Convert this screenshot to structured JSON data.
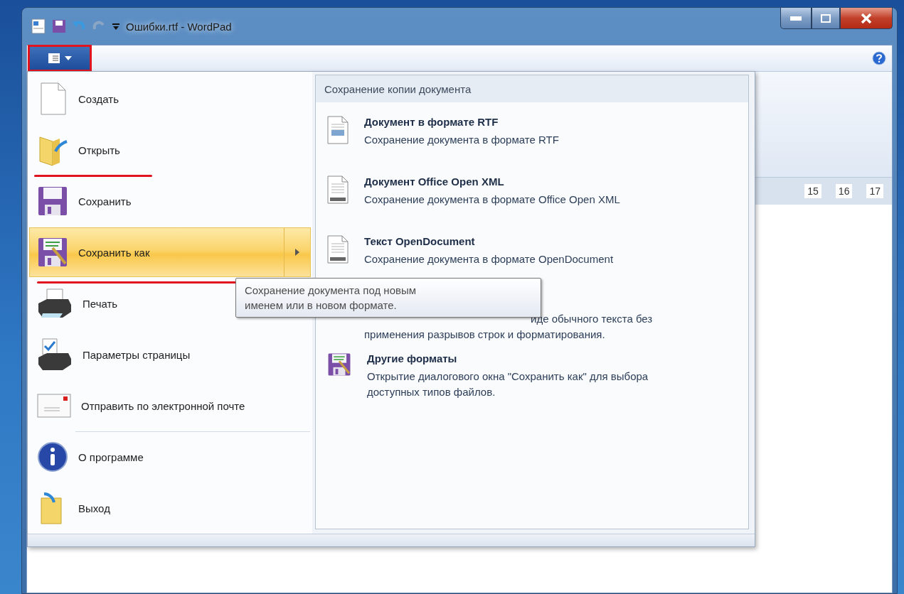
{
  "window": {
    "title": "Ошибки.rtf - WordPad"
  },
  "app_menu_button": {
    "highlighted": true
  },
  "ruler": {
    "marks": [
      "15",
      "16",
      "17"
    ]
  },
  "app_menu": {
    "items": [
      {
        "kind": "new",
        "label": "Создать",
        "selected": false,
        "submenu": false,
        "underlined": false,
        "separator_before": false
      },
      {
        "kind": "open",
        "label": "Открыть",
        "selected": false,
        "submenu": false,
        "underlined": true,
        "separator_before": false
      },
      {
        "kind": "save",
        "label": "Сохранить",
        "selected": false,
        "submenu": false,
        "underlined": false,
        "separator_before": false
      },
      {
        "kind": "saveas",
        "label": "Сохранить как",
        "selected": true,
        "submenu": true,
        "underlined": true,
        "separator_before": false
      },
      {
        "kind": "print",
        "label": "Печать",
        "selected": false,
        "submenu": false,
        "underlined": false,
        "separator_before": false
      },
      {
        "kind": "pagesetup",
        "label": "Параметры страницы",
        "selected": false,
        "submenu": false,
        "underlined": false,
        "separator_before": false
      },
      {
        "kind": "email",
        "label": "Отправить по электронной почте",
        "selected": false,
        "submenu": false,
        "underlined": false,
        "separator_before": false
      },
      {
        "kind": "about",
        "label": "О программе",
        "selected": false,
        "submenu": false,
        "underlined": false,
        "separator_before": true
      },
      {
        "kind": "exit",
        "label": "Выход",
        "selected": false,
        "submenu": false,
        "underlined": false,
        "separator_before": false
      }
    ]
  },
  "submenu": {
    "title": "Сохранение копии документа",
    "items": [
      {
        "kind": "rtf",
        "title": "Документ в формате RTF",
        "description": [
          "Сохранение документа в формате RTF"
        ]
      },
      {
        "kind": "docx",
        "title": "Документ Office Open XML",
        "description": [
          "Сохранение документа в формате Office Open XML"
        ]
      },
      {
        "kind": "odt",
        "title": "Текст OpenDocument",
        "description": [
          "Сохранение документа в формате OpenDocument"
        ]
      },
      {
        "kind": "covered",
        "description": [
          "иде обычного текста без",
          "применения разрывов строк и форматирования."
        ]
      },
      {
        "kind": "other",
        "title": "Другие форматы",
        "description": [
          "Открытие диалогового окна \"Сохранить как\" для выбора",
          "доступных типов файлов."
        ]
      }
    ]
  },
  "tooltip": {
    "lines": [
      "Сохранение документа под новым",
      "именем или в новом формате."
    ]
  }
}
